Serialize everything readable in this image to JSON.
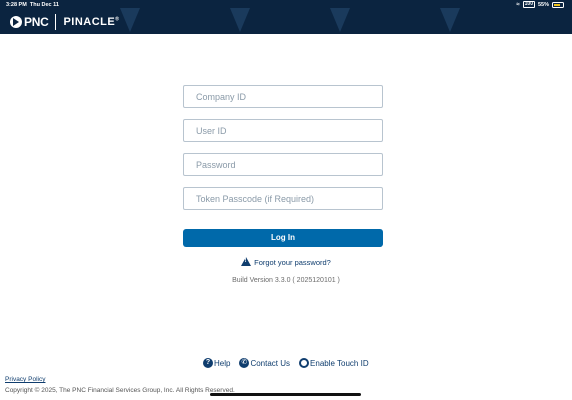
{
  "status_bar": {
    "time": "3:28 PM",
    "date": "Thu Dec 11",
    "alarm_badge": "100",
    "battery_percent": "55%"
  },
  "header": {
    "brand": "PNC",
    "product": "PINACLE",
    "trademark": "®",
    "background_color": "#0b2440"
  },
  "form": {
    "company_id_placeholder": "Company ID",
    "user_id_placeholder": "User ID",
    "password_placeholder": "Password",
    "token_placeholder": "Token Passcode (if Required)",
    "login_label": "Log In",
    "login_color": "#0069aa"
  },
  "forgot_password": "Forgot your password?",
  "build_version": "Build Version 3.3.0 ( 2025120101 )",
  "bottom_links": {
    "help": "Help",
    "contact": "Contact Us",
    "touch_id": "Enable Touch ID"
  },
  "footer": {
    "privacy": "Privacy Policy",
    "copyright": "Copyright © 2025, The PNC Financial Services Group, Inc. All Rights Reserved."
  },
  "icons": {
    "warning": "warning-icon",
    "help": "help-icon",
    "phone": "phone-icon",
    "touch_id": "fingerprint-icon"
  }
}
